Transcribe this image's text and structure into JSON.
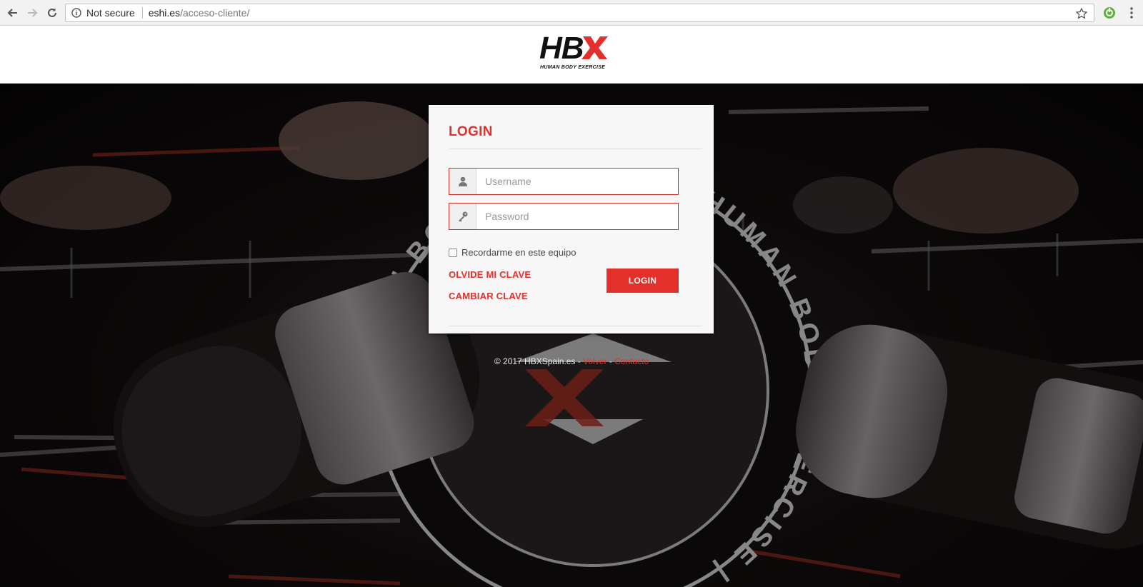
{
  "browser": {
    "security_label": "Not secure",
    "url_host": "eshi.es",
    "url_path": "/acceso-cliente/"
  },
  "logo": {
    "text": "HBX",
    "tagline": "HUMAN BODY EXERCISE"
  },
  "background_badge": {
    "ring_text": "HUMAN BODY EXERCISE | HUMAN BODY EXERCISE |"
  },
  "login": {
    "title": "LOGIN",
    "username_placeholder": "Username",
    "password_placeholder": "Password",
    "remember_label": "Recordarme en este equipo",
    "forgot_link": "OLVIDE MI CLAVE",
    "change_link": "CAMBIAR CLAVE",
    "submit_label": "LOGIN"
  },
  "footer": {
    "copyright": "© 2017 HBXSpain.es",
    "link_back": "Volver",
    "link_contact": "Contacto",
    "separator": " - "
  },
  "colors": {
    "accent": "#e3302b",
    "card_bg": "#f7f7f7",
    "header_bg": "#ffffff"
  }
}
